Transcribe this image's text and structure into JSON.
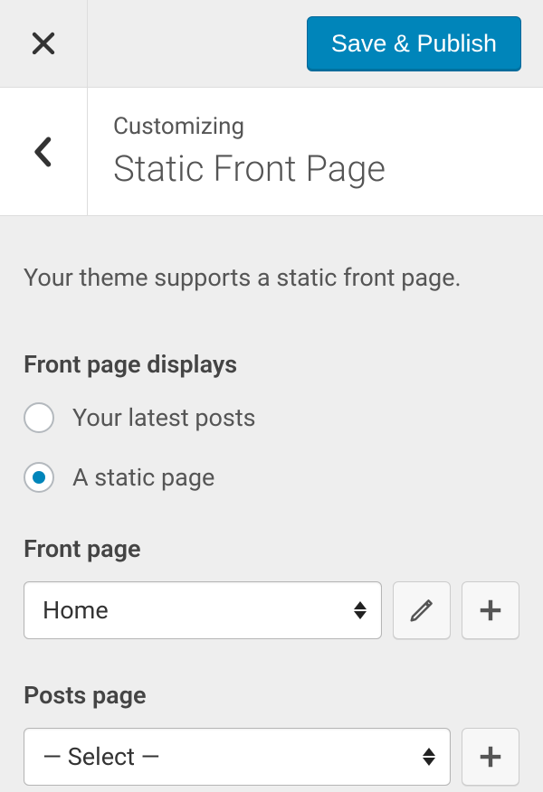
{
  "topbar": {
    "save_label": "Save & Publish"
  },
  "header": {
    "subtitle": "Customizing",
    "title": "Static Front Page"
  },
  "description": "Your theme supports a static front page.",
  "front_page_displays": {
    "label": "Front page displays",
    "options": [
      {
        "label": "Your latest posts",
        "selected": false
      },
      {
        "label": "A static page",
        "selected": true
      }
    ]
  },
  "front_page": {
    "label": "Front page",
    "value": "Home"
  },
  "posts_page": {
    "label": "Posts page",
    "value": "— Select —"
  }
}
